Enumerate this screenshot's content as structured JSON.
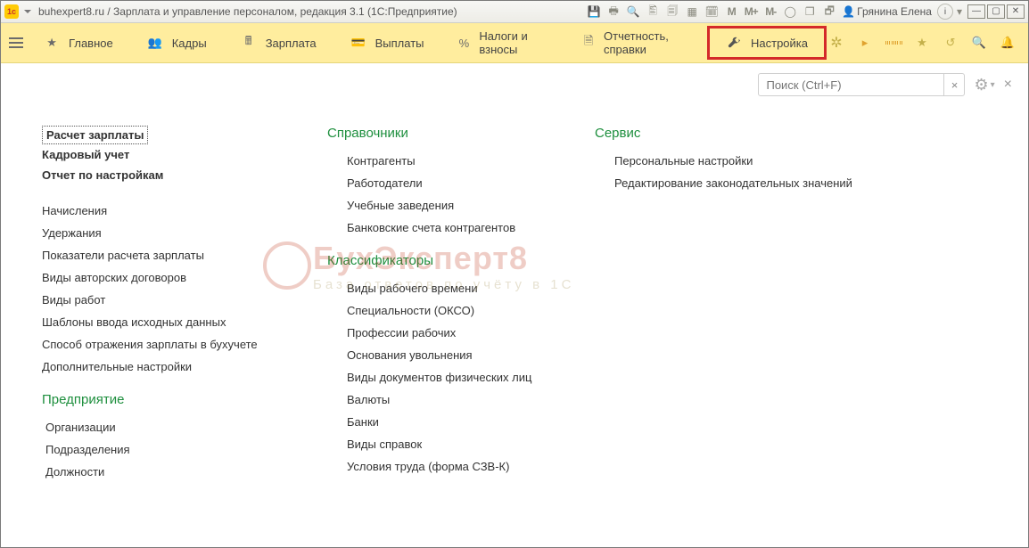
{
  "titlebar": {
    "title": "buhexpert8.ru / Зарплата и управление персоналом, редакция 3.1  (1С:Предприятие)",
    "user": "Грянина Елена",
    "m": "M",
    "mplus": "M+",
    "mminus": "M-"
  },
  "nav": {
    "main": "Главное",
    "hr": "Кадры",
    "salary": "Зарплата",
    "payments": "Выплаты",
    "taxes": "Налоги и взносы",
    "reports": "Отчетность, справки",
    "settings": "Настройка"
  },
  "search": {
    "placeholder": "Поиск (Ctrl+F)",
    "clear": "×"
  },
  "col1": {
    "bold1": "Расчет зарплаты",
    "bold2": "Кадровый учет",
    "bold3": "Отчет по настройкам",
    "l1": "Начисления",
    "l2": "Удержания",
    "l3": "Показатели расчета зарплаты",
    "l4": "Виды авторских договоров",
    "l5": "Виды работ",
    "l6": "Шаблоны ввода исходных данных",
    "l7": "Способ отражения зарплаты в бухучете",
    "l8": "Дополнительные настройки",
    "sec2": "Предприятие",
    "e1": "Организации",
    "e2": "Подразделения",
    "e3": "Должности"
  },
  "col2": {
    "sec1": "Справочники",
    "s1": "Контрагенты",
    "s2": "Работодатели",
    "s3": "Учебные заведения",
    "s4": "Банковские счета контрагентов",
    "sec2": "Классификаторы",
    "k1": "Виды рабочего времени",
    "k2": "Специальности (ОКСО)",
    "k3": "Профессии рабочих",
    "k4": "Основания увольнения",
    "k5": "Виды документов физических лиц",
    "k6": "Валюты",
    "k7": "Банки",
    "k8": "Виды справок",
    "k9": "Условия труда (форма СЗВ-К)"
  },
  "col3": {
    "sec": "Сервис",
    "v1": "Персональные настройки",
    "v2": "Редактирование законодательных значений"
  },
  "wm": {
    "ln1": "БухЭксперт8",
    "ln2": "База  ответов  по  учёту  в  1С"
  }
}
